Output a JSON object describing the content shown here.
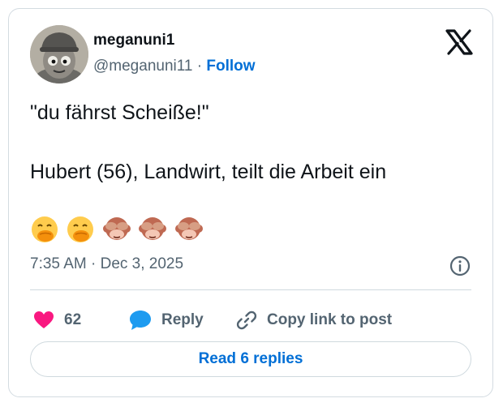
{
  "author": {
    "display_name": "meganuni1",
    "handle": "@meganuni11",
    "separator": "·",
    "follow_label": "Follow"
  },
  "tweet": {
    "line1": "\"du fährst Scheiße!\"",
    "line2": "Hubert (56), Landwirt, teilt die Arbeit ein",
    "emojis": [
      "face-with-hand-over-mouth",
      "face-with-hand-over-mouth",
      "see-no-evil-monkey",
      "see-no-evil-monkey",
      "see-no-evil-monkey"
    ],
    "timestamp": "7:35 AM · Dec 3, 2025"
  },
  "actions": {
    "like_count": "62",
    "reply_label": "Reply",
    "copy_label": "Copy link to post"
  },
  "read_replies_label": "Read 6 replies",
  "colors": {
    "like": "#f91880",
    "reply": "#1d9bf0",
    "link": "#006fd6",
    "muted": "#536471"
  }
}
